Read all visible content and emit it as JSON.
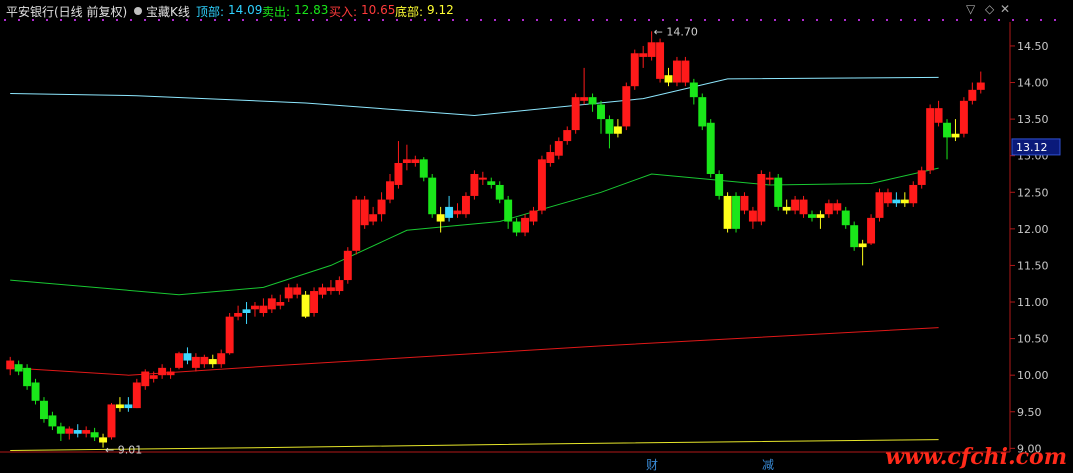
{
  "header": {
    "stock_title": "平安银行(日线 前复权)",
    "indicator_name": "宝藏K线",
    "top_label": "顶部:",
    "top_value": "14.09",
    "sell_label": "卖出:",
    "sell_value": "12.83",
    "buy_label": "买入:",
    "buy_value": "10.65",
    "bottom_label": "底部:",
    "bottom_value": "9.12",
    "colors": {
      "title": "#e0e0e0",
      "top": "#2fd2ff",
      "sell": "#19e619",
      "buy": "#ff3b3b",
      "bottom": "#ffff33"
    }
  },
  "price_axis": {
    "ticks": [
      "14.50",
      "14.00",
      "13.50",
      "13.00",
      "12.50",
      "12.00",
      "11.50",
      "11.00",
      "10.50",
      "10.00",
      "9.50",
      "9.00"
    ],
    "current_price": "13.12"
  },
  "annotations": {
    "high_label": "14.70",
    "low_label": "9.01",
    "high_arrow": "←",
    "low_arrow": "←"
  },
  "events": {
    "event1": "财",
    "event2": "减"
  },
  "watermark": "www.cfchi.com",
  "chart_data": {
    "type": "candlestick",
    "ylim": [
      8.95,
      14.8
    ],
    "line_colors": {
      "top": "#8ee8ff",
      "sell": "#19c832",
      "buy": "#e01818",
      "bottom": "#e6e62a"
    },
    "lines": {
      "top_line": [
        [
          0,
          13.85
        ],
        [
          15,
          13.82
        ],
        [
          35,
          13.72
        ],
        [
          55,
          13.55
        ],
        [
          75,
          13.78
        ],
        [
          85,
          14.05
        ],
        [
          110,
          14.07
        ]
      ],
      "sell_line": [
        [
          0,
          11.3
        ],
        [
          20,
          11.1
        ],
        [
          30,
          11.2
        ],
        [
          38,
          11.5
        ],
        [
          47,
          11.98
        ],
        [
          58,
          12.1
        ],
        [
          70,
          12.5
        ],
        [
          76,
          12.75
        ],
        [
          90,
          12.6
        ],
        [
          102,
          12.62
        ],
        [
          110,
          12.83
        ]
      ],
      "buy_line": [
        [
          0,
          10.1
        ],
        [
          14,
          10.0
        ],
        [
          30,
          10.12
        ],
        [
          70,
          10.4
        ],
        [
          110,
          10.65
        ]
      ],
      "bottom_line": [
        [
          0,
          8.97
        ],
        [
          30,
          9.01
        ],
        [
          70,
          9.07
        ],
        [
          110,
          9.12
        ]
      ]
    },
    "candles": [
      {
        "o": 10.2,
        "c": 10.08,
        "h": 10.25,
        "l": 10.0,
        "k": "r"
      },
      {
        "o": 10.15,
        "c": 10.05,
        "h": 10.2,
        "l": 10.0,
        "k": "g"
      },
      {
        "o": 10.1,
        "c": 9.85,
        "h": 10.15,
        "l": 9.8,
        "k": "g"
      },
      {
        "o": 9.9,
        "c": 9.65,
        "h": 9.95,
        "l": 9.6,
        "k": "g"
      },
      {
        "o": 9.65,
        "c": 9.4,
        "h": 9.7,
        "l": 9.35,
        "k": "g"
      },
      {
        "o": 9.45,
        "c": 9.3,
        "h": 9.5,
        "l": 9.25,
        "k": "g"
      },
      {
        "o": 9.3,
        "c": 9.2,
        "h": 9.35,
        "l": 9.1,
        "k": "g"
      },
      {
        "o": 9.2,
        "c": 9.27,
        "h": 9.3,
        "l": 9.12,
        "k": "r"
      },
      {
        "o": 9.25,
        "c": 9.2,
        "h": 9.33,
        "l": 9.15,
        "k": "c"
      },
      {
        "o": 9.2,
        "c": 9.25,
        "h": 9.3,
        "l": 9.15,
        "k": "r"
      },
      {
        "o": 9.22,
        "c": 9.15,
        "h": 9.28,
        "l": 9.1,
        "k": "g"
      },
      {
        "o": 9.15,
        "c": 9.08,
        "h": 9.2,
        "l": 9.01,
        "k": "y"
      },
      {
        "o": 9.15,
        "c": 9.6,
        "h": 9.62,
        "l": 9.12,
        "k": "r"
      },
      {
        "o": 9.55,
        "c": 9.6,
        "h": 9.7,
        "l": 9.5,
        "k": "y"
      },
      {
        "o": 9.6,
        "c": 9.55,
        "h": 9.7,
        "l": 9.5,
        "k": "c"
      },
      {
        "o": 9.55,
        "c": 9.9,
        "h": 9.95,
        "l": 9.55,
        "k": "r"
      },
      {
        "o": 9.85,
        "c": 10.05,
        "h": 10.08,
        "l": 9.8,
        "k": "r"
      },
      {
        "o": 10.0,
        "c": 9.95,
        "h": 10.05,
        "l": 9.9,
        "k": "r"
      },
      {
        "o": 10.0,
        "c": 10.1,
        "h": 10.15,
        "l": 9.95,
        "k": "r"
      },
      {
        "o": 10.05,
        "c": 10.0,
        "h": 10.1,
        "l": 9.95,
        "k": "r"
      },
      {
        "o": 10.1,
        "c": 10.3,
        "h": 10.32,
        "l": 10.08,
        "k": "r"
      },
      {
        "o": 10.3,
        "c": 10.2,
        "h": 10.38,
        "l": 10.15,
        "k": "c"
      },
      {
        "o": 10.25,
        "c": 10.1,
        "h": 10.3,
        "l": 10.05,
        "k": "r"
      },
      {
        "o": 10.15,
        "c": 10.25,
        "h": 10.28,
        "l": 10.1,
        "k": "r"
      },
      {
        "o": 10.22,
        "c": 10.15,
        "h": 10.28,
        "l": 10.1,
        "k": "y"
      },
      {
        "o": 10.15,
        "c": 10.3,
        "h": 10.35,
        "l": 10.1,
        "k": "r"
      },
      {
        "o": 10.3,
        "c": 10.8,
        "h": 10.85,
        "l": 10.28,
        "k": "r"
      },
      {
        "o": 10.8,
        "c": 10.85,
        "h": 10.95,
        "l": 10.75,
        "k": "r"
      },
      {
        "o": 10.85,
        "c": 10.9,
        "h": 11.0,
        "l": 10.7,
        "k": "c"
      },
      {
        "o": 10.9,
        "c": 10.95,
        "h": 11.0,
        "l": 10.8,
        "k": "r"
      },
      {
        "o": 10.95,
        "c": 10.85,
        "h": 11.05,
        "l": 10.8,
        "k": "r"
      },
      {
        "o": 10.9,
        "c": 11.05,
        "h": 11.1,
        "l": 10.85,
        "k": "r"
      },
      {
        "o": 11.0,
        "c": 10.95,
        "h": 11.1,
        "l": 10.9,
        "k": "r"
      },
      {
        "o": 11.05,
        "c": 11.2,
        "h": 11.25,
        "l": 11.0,
        "k": "r"
      },
      {
        "o": 11.2,
        "c": 11.1,
        "h": 11.25,
        "l": 11.05,
        "k": "r"
      },
      {
        "o": 11.1,
        "c": 10.8,
        "h": 11.15,
        "l": 10.78,
        "k": "y"
      },
      {
        "o": 10.85,
        "c": 11.15,
        "h": 11.2,
        "l": 10.8,
        "k": "r"
      },
      {
        "o": 11.1,
        "c": 11.2,
        "h": 11.25,
        "l": 11.05,
        "k": "r"
      },
      {
        "o": 11.2,
        "c": 11.15,
        "h": 11.3,
        "l": 11.1,
        "k": "r"
      },
      {
        "o": 11.15,
        "c": 11.3,
        "h": 11.35,
        "l": 11.1,
        "k": "r"
      },
      {
        "o": 11.3,
        "c": 11.7,
        "h": 11.75,
        "l": 11.25,
        "k": "r"
      },
      {
        "o": 11.7,
        "c": 12.4,
        "h": 12.45,
        "l": 11.65,
        "k": "r"
      },
      {
        "o": 12.4,
        "c": 12.05,
        "h": 12.45,
        "l": 12.0,
        "k": "r"
      },
      {
        "o": 12.1,
        "c": 12.2,
        "h": 12.3,
        "l": 12.05,
        "k": "r"
      },
      {
        "o": 12.2,
        "c": 12.4,
        "h": 12.5,
        "l": 12.1,
        "k": "r"
      },
      {
        "o": 12.4,
        "c": 12.65,
        "h": 12.75,
        "l": 12.35,
        "k": "r"
      },
      {
        "o": 12.6,
        "c": 12.9,
        "h": 13.2,
        "l": 12.55,
        "k": "r"
      },
      {
        "o": 12.9,
        "c": 12.95,
        "h": 13.15,
        "l": 12.8,
        "k": "r"
      },
      {
        "o": 12.95,
        "c": 12.9,
        "h": 13.0,
        "l": 12.85,
        "k": "r"
      },
      {
        "o": 12.95,
        "c": 12.7,
        "h": 12.98,
        "l": 12.65,
        "k": "g"
      },
      {
        "o": 12.7,
        "c": 12.2,
        "h": 12.75,
        "l": 12.15,
        "k": "g"
      },
      {
        "o": 12.2,
        "c": 12.1,
        "h": 12.3,
        "l": 11.95,
        "k": "y"
      },
      {
        "o": 12.15,
        "c": 12.3,
        "h": 12.45,
        "l": 12.1,
        "k": "c"
      },
      {
        "o": 12.25,
        "c": 12.2,
        "h": 12.35,
        "l": 12.15,
        "k": "r"
      },
      {
        "o": 12.2,
        "c": 12.45,
        "h": 12.5,
        "l": 12.15,
        "k": "r"
      },
      {
        "o": 12.45,
        "c": 12.75,
        "h": 12.8,
        "l": 12.4,
        "k": "r"
      },
      {
        "o": 12.7,
        "c": 12.7,
        "h": 12.78,
        "l": 12.6,
        "k": "r"
      },
      {
        "o": 12.65,
        "c": 12.6,
        "h": 12.7,
        "l": 12.55,
        "k": "g"
      },
      {
        "o": 12.6,
        "c": 12.4,
        "h": 12.65,
        "l": 12.35,
        "k": "g"
      },
      {
        "o": 12.4,
        "c": 12.1,
        "h": 12.45,
        "l": 12.0,
        "k": "g"
      },
      {
        "o": 12.1,
        "c": 11.95,
        "h": 12.15,
        "l": 11.9,
        "k": "g"
      },
      {
        "o": 11.95,
        "c": 12.15,
        "h": 12.2,
        "l": 11.9,
        "k": "r"
      },
      {
        "o": 12.1,
        "c": 12.25,
        "h": 12.3,
        "l": 12.05,
        "k": "r"
      },
      {
        "o": 12.25,
        "c": 12.95,
        "h": 13.0,
        "l": 12.2,
        "k": "r"
      },
      {
        "o": 12.9,
        "c": 13.05,
        "h": 13.15,
        "l": 12.85,
        "k": "r"
      },
      {
        "o": 13.0,
        "c": 13.2,
        "h": 13.25,
        "l": 12.95,
        "k": "r"
      },
      {
        "o": 13.2,
        "c": 13.35,
        "h": 13.4,
        "l": 13.15,
        "k": "r"
      },
      {
        "o": 13.35,
        "c": 13.8,
        "h": 13.85,
        "l": 13.3,
        "k": "r"
      },
      {
        "o": 13.75,
        "c": 13.8,
        "h": 14.2,
        "l": 13.7,
        "k": "r"
      },
      {
        "o": 13.8,
        "c": 13.7,
        "h": 13.85,
        "l": 13.6,
        "k": "g"
      },
      {
        "o": 13.7,
        "c": 13.5,
        "h": 13.75,
        "l": 13.3,
        "k": "g"
      },
      {
        "o": 13.5,
        "c": 13.3,
        "h": 13.55,
        "l": 13.1,
        "k": "g"
      },
      {
        "o": 13.3,
        "c": 13.4,
        "h": 13.5,
        "l": 13.25,
        "k": "y"
      },
      {
        "o": 13.4,
        "c": 13.95,
        "h": 14.0,
        "l": 13.35,
        "k": "r"
      },
      {
        "o": 13.95,
        "c": 14.4,
        "h": 14.45,
        "l": 13.9,
        "k": "r"
      },
      {
        "o": 14.4,
        "c": 14.35,
        "h": 14.5,
        "l": 14.2,
        "k": "r"
      },
      {
        "o": 14.35,
        "c": 14.55,
        "h": 14.7,
        "l": 14.3,
        "k": "r"
      },
      {
        "o": 14.55,
        "c": 14.05,
        "h": 14.6,
        "l": 14.0,
        "k": "r"
      },
      {
        "o": 14.1,
        "c": 14.0,
        "h": 14.2,
        "l": 13.95,
        "k": "y"
      },
      {
        "o": 14.0,
        "c": 14.3,
        "h": 14.35,
        "l": 13.95,
        "k": "r"
      },
      {
        "o": 14.3,
        "c": 14.0,
        "h": 14.35,
        "l": 13.95,
        "k": "r"
      },
      {
        "o": 14.0,
        "c": 13.8,
        "h": 14.05,
        "l": 13.7,
        "k": "g"
      },
      {
        "o": 13.8,
        "c": 13.4,
        "h": 13.85,
        "l": 13.35,
        "k": "g"
      },
      {
        "o": 13.45,
        "c": 12.75,
        "h": 13.5,
        "l": 12.7,
        "k": "g"
      },
      {
        "o": 12.75,
        "c": 12.45,
        "h": 12.8,
        "l": 12.4,
        "k": "g"
      },
      {
        "o": 12.45,
        "c": 12.0,
        "h": 12.5,
        "l": 11.95,
        "k": "y"
      },
      {
        "o": 12.0,
        "c": 12.45,
        "h": 12.5,
        "l": 11.95,
        "k": "g"
      },
      {
        "o": 12.45,
        "c": 12.25,
        "h": 12.5,
        "l": 12.2,
        "k": "r"
      },
      {
        "o": 12.25,
        "c": 12.1,
        "h": 12.3,
        "l": 12.0,
        "k": "r"
      },
      {
        "o": 12.1,
        "c": 12.75,
        "h": 12.8,
        "l": 12.05,
        "k": "r"
      },
      {
        "o": 12.7,
        "c": 12.7,
        "h": 12.78,
        "l": 12.6,
        "k": "r"
      },
      {
        "o": 12.7,
        "c": 12.3,
        "h": 12.75,
        "l": 12.25,
        "k": "g"
      },
      {
        "o": 12.3,
        "c": 12.25,
        "h": 12.4,
        "l": 12.2,
        "k": "y"
      },
      {
        "o": 12.25,
        "c": 12.4,
        "h": 12.45,
        "l": 12.2,
        "k": "r"
      },
      {
        "o": 12.4,
        "c": 12.2,
        "h": 12.45,
        "l": 12.15,
        "k": "r"
      },
      {
        "o": 12.2,
        "c": 12.15,
        "h": 12.25,
        "l": 12.1,
        "k": "g"
      },
      {
        "o": 12.15,
        "c": 12.2,
        "h": 12.25,
        "l": 12.0,
        "k": "y"
      },
      {
        "o": 12.2,
        "c": 12.35,
        "h": 12.4,
        "l": 12.15,
        "k": "r"
      },
      {
        "o": 12.35,
        "c": 12.25,
        "h": 12.4,
        "l": 12.2,
        "k": "r"
      },
      {
        "o": 12.25,
        "c": 12.05,
        "h": 12.3,
        "l": 12.0,
        "k": "g"
      },
      {
        "o": 12.05,
        "c": 11.75,
        "h": 12.1,
        "l": 11.7,
        "k": "g"
      },
      {
        "o": 11.75,
        "c": 11.8,
        "h": 11.85,
        "l": 11.5,
        "k": "y"
      },
      {
        "o": 11.8,
        "c": 12.15,
        "h": 12.2,
        "l": 11.78,
        "k": "r"
      },
      {
        "o": 12.15,
        "c": 12.5,
        "h": 12.55,
        "l": 12.1,
        "k": "r"
      },
      {
        "o": 12.5,
        "c": 12.35,
        "h": 12.55,
        "l": 12.3,
        "k": "r"
      },
      {
        "o": 12.35,
        "c": 12.4,
        "h": 12.5,
        "l": 12.3,
        "k": "c"
      },
      {
        "o": 12.4,
        "c": 12.35,
        "h": 12.5,
        "l": 12.3,
        "k": "y"
      },
      {
        "o": 12.35,
        "c": 12.6,
        "h": 12.65,
        "l": 12.3,
        "k": "r"
      },
      {
        "o": 12.6,
        "c": 12.8,
        "h": 12.85,
        "l": 12.55,
        "k": "r"
      },
      {
        "o": 12.8,
        "c": 13.65,
        "h": 13.7,
        "l": 12.75,
        "k": "r"
      },
      {
        "o": 13.65,
        "c": 13.45,
        "h": 13.75,
        "l": 13.4,
        "k": "r"
      },
      {
        "o": 13.45,
        "c": 13.25,
        "h": 13.5,
        "l": 12.95,
        "k": "g"
      },
      {
        "o": 13.25,
        "c": 13.3,
        "h": 13.5,
        "l": 13.2,
        "k": "y"
      },
      {
        "o": 13.3,
        "c": 13.75,
        "h": 13.8,
        "l": 13.25,
        "k": "r"
      },
      {
        "o": 13.75,
        "c": 13.9,
        "h": 14.0,
        "l": 13.7,
        "k": "r"
      },
      {
        "o": 13.9,
        "c": 14.0,
        "h": 14.15,
        "l": 13.85,
        "k": "r"
      }
    ]
  }
}
